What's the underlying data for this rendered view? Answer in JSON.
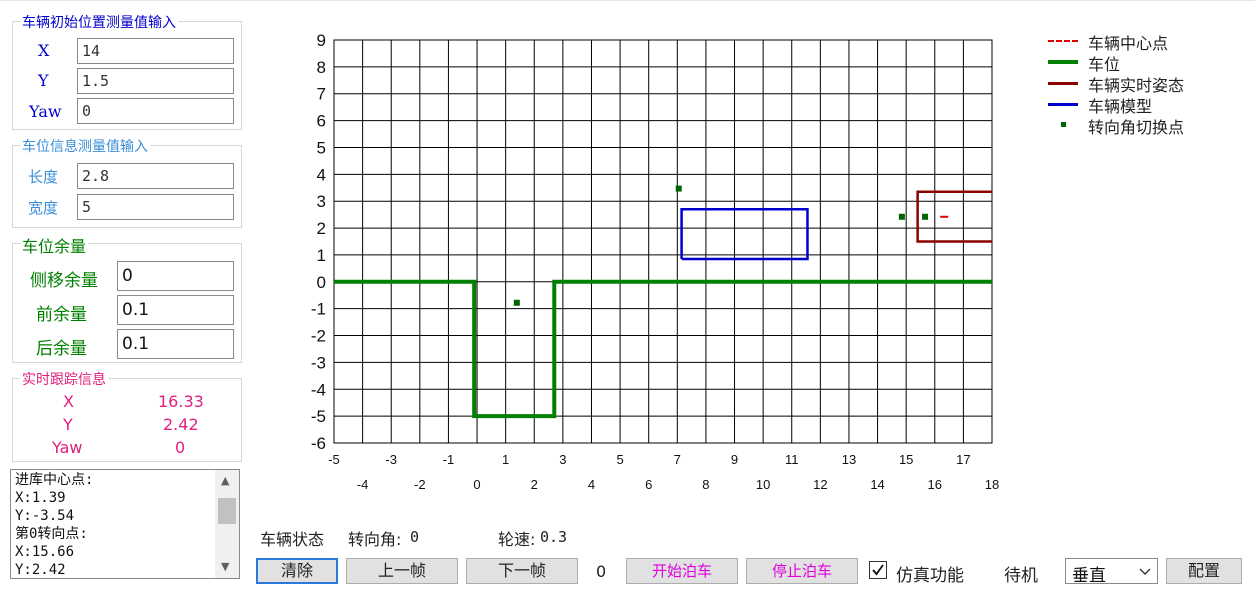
{
  "initial_position": {
    "title": "车辆初始位置测量值输入",
    "x_label": "X",
    "x_value": "14",
    "y_label": "Y",
    "y_value": "1.5",
    "yaw_label": "Yaw",
    "yaw_value": "0"
  },
  "parking_info": {
    "title": "车位信息测量值输入",
    "length_label": "长度",
    "length_value": "2.8",
    "width_label": "宽度",
    "width_value": "5"
  },
  "margin": {
    "title": "车位余量",
    "side_label": "侧移余量",
    "side_value": "0",
    "front_label": "前余量",
    "front_value": "0.1",
    "rear_label": "后余量",
    "rear_value": "0.1"
  },
  "tracking": {
    "title": "实时跟踪信息",
    "x_label": "X",
    "x_value": "16.33",
    "y_label": "Y",
    "y_value": "2.42",
    "yaw_label": "Yaw",
    "yaw_value": "0"
  },
  "log": {
    "lines": [
      "进库中心点:",
      "X:1.39",
      "Y:-3.54",
      "第0转向点:",
      "X:15.66",
      "Y:2.42"
    ]
  },
  "status": {
    "label": "车辆状态",
    "steer_label": "转向角:",
    "steer_value": "0",
    "speed_label": "轮速:",
    "speed_value": "0.3"
  },
  "toolbar": {
    "clear": "清除",
    "prev_frame": "上一帧",
    "next_frame": "下一帧",
    "frame_counter": "0",
    "start_parking": "开始泊车",
    "stop_parking": "停止泊车",
    "sim_label": "仿真功能",
    "sim_checked": true,
    "standby": "待机",
    "mode_value": "垂直",
    "config": "配置"
  },
  "legend": [
    {
      "label": "车辆中心点",
      "color": "#e00000",
      "style": "dashed"
    },
    {
      "label": "车位",
      "color": "#008000",
      "style": "solid-thick"
    },
    {
      "label": "车辆实时姿态",
      "color": "#8b0000",
      "style": "solid"
    },
    {
      "label": "车辆模型",
      "color": "#0000cc",
      "style": "solid"
    },
    {
      "label": "转向角切换点",
      "color": "#006400",
      "style": "marker"
    }
  ],
  "chart_data": {
    "type": "scatter",
    "xlim": [
      -5,
      18
    ],
    "ylim": [
      -6,
      9
    ],
    "grid": true,
    "legend_position": "top-right",
    "x_ticks_row1": [
      -5,
      -3,
      -1,
      1,
      3,
      5,
      7,
      9,
      11,
      13,
      15,
      17
    ],
    "x_ticks_row2": [
      -4,
      -2,
      0,
      2,
      4,
      6,
      8,
      10,
      12,
      14,
      16,
      18
    ],
    "y_ticks": [
      9,
      8,
      7,
      6,
      5,
      4,
      3,
      2,
      1,
      0,
      -1,
      -2,
      -3,
      -4,
      -5,
      -6
    ],
    "parking_slot": {
      "name": "车位",
      "color": "#008000",
      "x": [
        -5,
        -0.1,
        -0.1,
        2.7,
        2.7,
        18
      ],
      "y": [
        0,
        0,
        -5,
        -5,
        0,
        0
      ]
    },
    "vehicle_model": {
      "name": "车辆模型",
      "color": "#0000cc",
      "x": [
        7.15,
        11.55,
        11.55,
        7.15,
        7.15
      ],
      "y": [
        0.85,
        0.85,
        2.7,
        2.7,
        0.85
      ]
    },
    "vehicle_pose": {
      "name": "车辆实时姿态",
      "color": "#8b0000",
      "x": [
        18,
        15.4,
        15.4,
        18
      ],
      "y": [
        3.35,
        3.35,
        1.5,
        1.5
      ]
    },
    "vehicle_center": {
      "name": "车辆中心点",
      "color": "#e00000",
      "x": 16.33,
      "y": 2.42
    },
    "switch_points": {
      "name": "转向角切换点",
      "color": "#006400",
      "points": [
        [
          1.39,
          -0.78
        ],
        [
          7.05,
          3.47
        ],
        [
          14.85,
          2.42
        ],
        [
          15.66,
          2.42
        ]
      ]
    }
  }
}
